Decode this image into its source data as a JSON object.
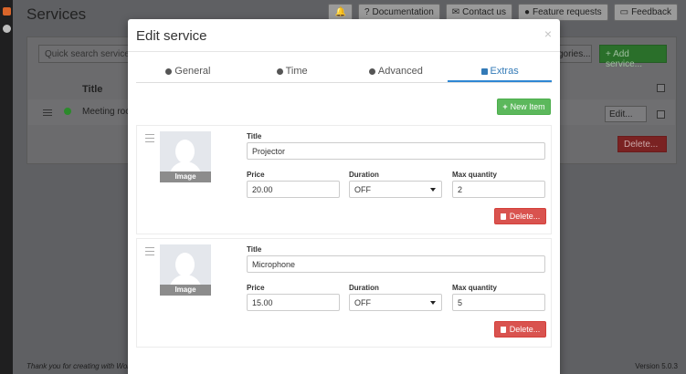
{
  "background": {
    "page_title": "Services",
    "top_buttons": [
      {
        "label": "",
        "icon": "bell-icon"
      },
      {
        "label": "Documentation",
        "icon": "question-circle-icon"
      },
      {
        "label": "Contact us",
        "icon": "envelope-icon"
      },
      {
        "label": "Feature requests",
        "icon": "lightbulb-icon"
      },
      {
        "label": "Feedback",
        "icon": "comment-icon"
      }
    ],
    "search_placeholder": "Quick search services",
    "categories_label": "gories...",
    "add_service_label": "+ Add service...",
    "column_title": "Title",
    "row_title": "Meeting room",
    "edit_label": "Edit...",
    "delete_label": "Delete...",
    "footer_left": "Thank you for creating with WordPress.",
    "footer_right": "Version 5.0.3"
  },
  "modal": {
    "title": "Edit service",
    "close": "×",
    "tabs": [
      {
        "label": "General",
        "icon": "gear-icon",
        "active": false
      },
      {
        "label": "Time",
        "icon": "clock-icon",
        "active": false
      },
      {
        "label": "Advanced",
        "icon": "gears-icon",
        "active": false
      },
      {
        "label": "Extras",
        "icon": "briefcase-icon",
        "active": true
      }
    ],
    "new_item_label": "New Item",
    "field_labels": {
      "title": "Title",
      "price": "Price",
      "duration": "Duration",
      "max_quantity": "Max quantity"
    },
    "image_label": "Image",
    "delete_label": "Delete...",
    "extras": [
      {
        "title": "Projector",
        "price": "20.00",
        "duration": "OFF",
        "max_quantity": "2"
      },
      {
        "title": "Microphone",
        "price": "15.00",
        "duration": "OFF",
        "max_quantity": "5"
      }
    ]
  },
  "colors": {
    "primary": "#337ab7",
    "success": "#5cb85c",
    "danger": "#d9534f"
  }
}
